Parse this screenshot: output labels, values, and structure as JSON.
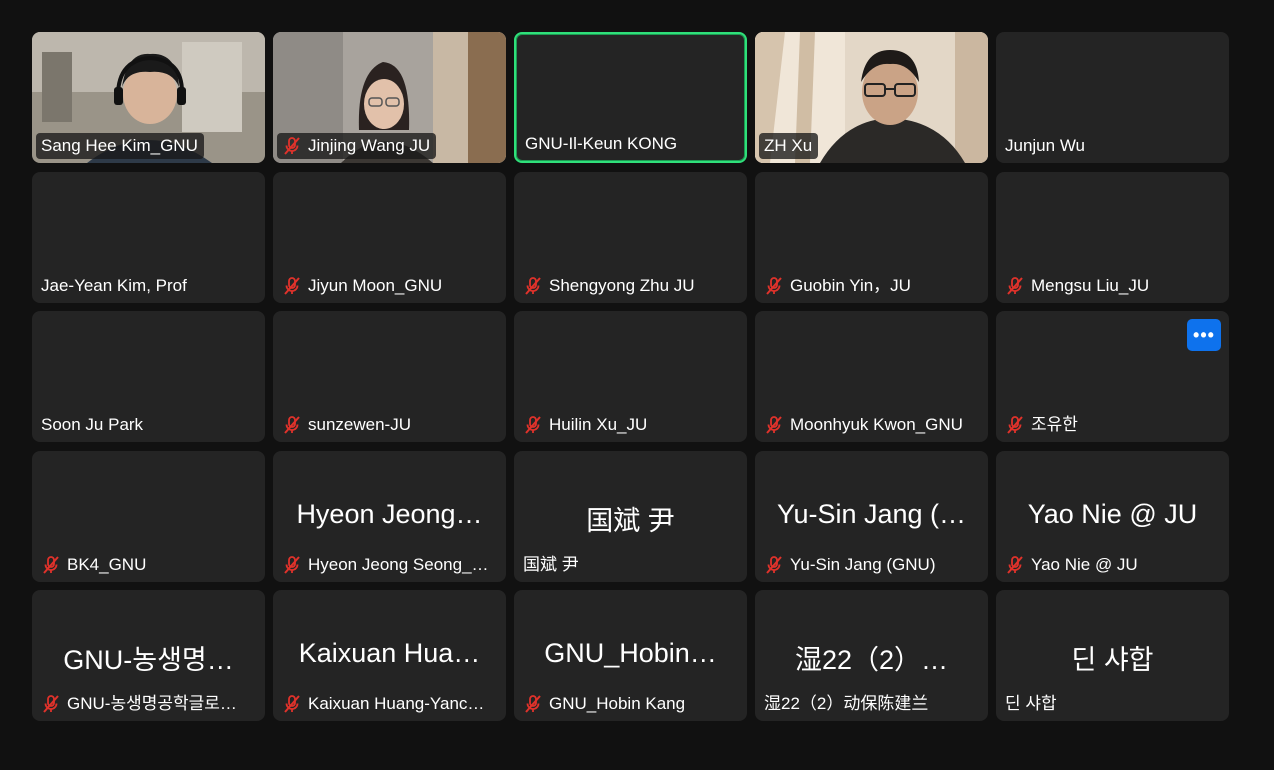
{
  "participants": [
    {
      "name": "Sang Hee Kim_GNU",
      "muted": false,
      "video": "video-sang-hee-kim",
      "display_name": ""
    },
    {
      "name": "Jinjing Wang JU",
      "muted": true,
      "video": "video-jinjing-wang",
      "display_name": ""
    },
    {
      "name": "GNU-Il-Keun KONG",
      "muted": false,
      "video": "",
      "speaking": true,
      "display_name": ""
    },
    {
      "name": "ZH Xu",
      "muted": false,
      "video": "video-zh-xu",
      "display_name": ""
    },
    {
      "name": "Junjun Wu",
      "muted": false,
      "video": "",
      "display_name": ""
    },
    {
      "name": "Jae-Yean Kim, Prof",
      "muted": false,
      "video": "",
      "display_name": ""
    },
    {
      "name": "Jiyun Moon_GNU",
      "muted": true,
      "video": "",
      "display_name": ""
    },
    {
      "name": "Shengyong Zhu JU",
      "muted": true,
      "video": "",
      "display_name": ""
    },
    {
      "name": "Guobin Yin，JU",
      "muted": true,
      "video": "",
      "display_name": ""
    },
    {
      "name": "Mengsu Liu_JU",
      "muted": true,
      "video": "",
      "display_name": ""
    },
    {
      "name": "Soon Ju Park",
      "muted": false,
      "video": "",
      "display_name": ""
    },
    {
      "name": "sunzewen-JU",
      "muted": true,
      "video": "",
      "display_name": ""
    },
    {
      "name": "Huilin Xu_JU",
      "muted": true,
      "video": "",
      "display_name": ""
    },
    {
      "name": "Moonhyuk Kwon_GNU",
      "muted": true,
      "video": "",
      "display_name": ""
    },
    {
      "name": "조유한",
      "muted": true,
      "video": "",
      "display_name": "",
      "more_button": "•••"
    },
    {
      "name": "BK4_GNU",
      "muted": true,
      "video": "",
      "display_name": ""
    },
    {
      "name": "Hyeon Jeong Seong_…",
      "muted": true,
      "video": "",
      "display_name": "Hyeon Jeong…"
    },
    {
      "name": "国斌 尹",
      "muted": false,
      "video": "",
      "display_name": "国斌 尹"
    },
    {
      "name": "Yu-Sin Jang (GNU)",
      "muted": true,
      "video": "",
      "display_name": "Yu-Sin Jang (…"
    },
    {
      "name": "Yao Nie @ JU",
      "muted": true,
      "video": "",
      "display_name": "Yao Nie @ JU"
    },
    {
      "name": "GNU-농생명공학글로컬…",
      "muted": true,
      "video": "",
      "display_name": "GNU-농생명…"
    },
    {
      "name": "Kaixuan Huang-Yanc…",
      "muted": true,
      "video": "",
      "display_name": "Kaixuan Hua…"
    },
    {
      "name": "GNU_Hobin Kang",
      "muted": true,
      "video": "",
      "display_name": "GNU_Hobin…"
    },
    {
      "name": "湿22（2）动保陈建兰",
      "muted": false,
      "video": "",
      "display_name": "湿22（2）…"
    },
    {
      "name": "딘 샤합",
      "muted": false,
      "video": "",
      "display_name": "딘 샤합"
    }
  ],
  "colors": {
    "background": "#111111",
    "tile": "#242424",
    "active_speaker_border": "#2fe07a",
    "mute_icon": "#e0322b",
    "accent_button": "#0e72ed"
  }
}
